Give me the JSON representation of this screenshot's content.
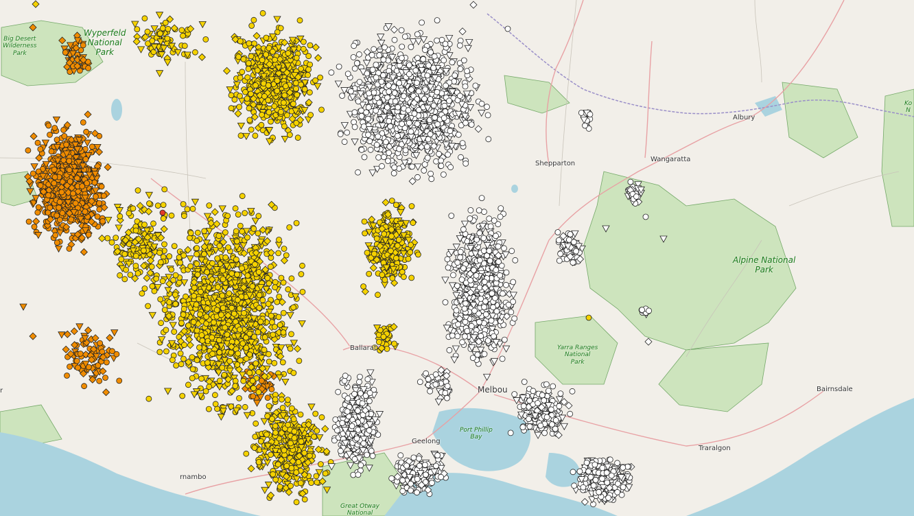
{
  "map": {
    "colors": {
      "land": "#f2efe9",
      "water": "#aad3df",
      "park": "#cde4bd",
      "park_border": "#74a868",
      "road": "#e8a1a4",
      "state_border": "#9a8fc8",
      "marker_white": "#ffffff",
      "marker_yellow": "#f5d200",
      "marker_orange": "#f08c00",
      "marker_red": "#e23b2a",
      "marker_stroke": "#222222"
    },
    "places": {
      "albury": "Albury",
      "wangaratta": "Wangaratta",
      "shepparton": "Shepparton",
      "ballarat": "Ballarat",
      "melbourne": "Melbou",
      "geelong": "Geelong",
      "bairnsdale": "Bairnsdale",
      "traralgon": "Traralgon",
      "warrnambool": "rnambo",
      "edge_r": "r"
    },
    "parks": {
      "big_desert": "Big Desert\nWilderness\nPark",
      "wyperfeld": "Wyperfeld\nNational\nPark",
      "alpine": "Alpine National\nPark",
      "yarra_ranges": "Yarra Ranges\nNational\nPark",
      "port_phillip": "Port Phillip\nBay",
      "otway": "Great Otway\nNational",
      "kosciuszko": "Ko\nN"
    },
    "markers": {
      "shapes": [
        "circle",
        "triangle",
        "diamond"
      ],
      "categories": [
        "white",
        "yellow",
        "orange",
        "red"
      ]
    }
  }
}
